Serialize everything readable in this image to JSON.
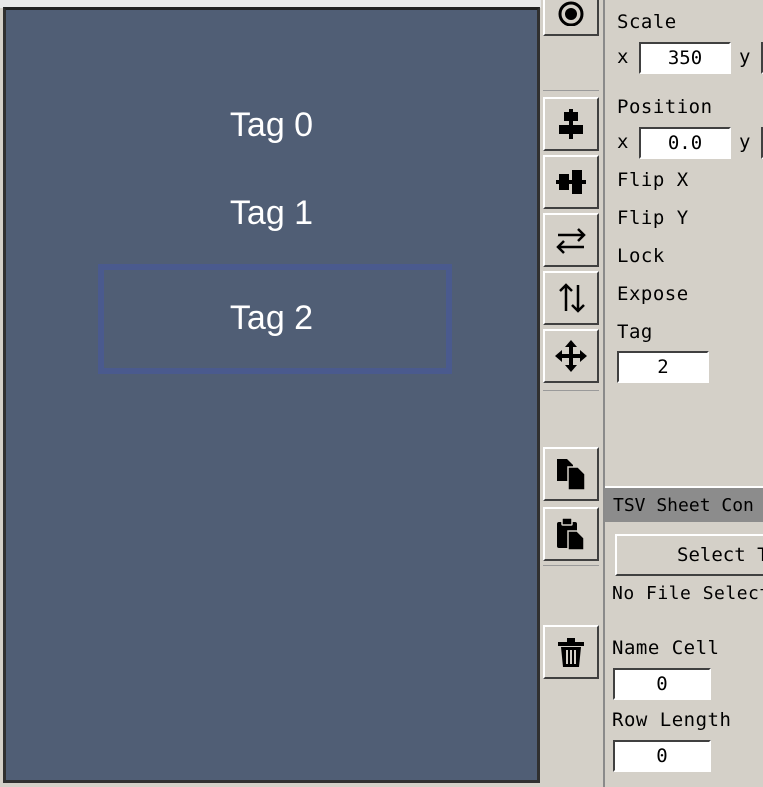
{
  "canvas": {
    "tags": [
      "Tag 0",
      "Tag 1",
      "Tag 2"
    ],
    "selected_index": 2
  },
  "toolbar": {
    "buttons": [
      {
        "name": "record-icon"
      },
      {
        "name": "align-vertical-icon"
      },
      {
        "name": "align-horizontal-icon"
      },
      {
        "name": "flip-horizontal-icon"
      },
      {
        "name": "flip-vertical-icon"
      },
      {
        "name": "move-icon"
      },
      {
        "name": "copy-icon"
      },
      {
        "name": "paste-icon"
      },
      {
        "name": "delete-icon"
      }
    ]
  },
  "properties": {
    "scale_label": "Scale",
    "scale_x_label": "x",
    "scale_x_value": "350",
    "scale_y_label": "y",
    "position_label": "Position",
    "position_x_label": "x",
    "position_x_value": "0.0",
    "position_y_label": "y",
    "flip_x_label": "Flip X",
    "flip_y_label": "Flip Y",
    "lock_label": "Lock",
    "expose_label": "Expose",
    "tag_label": "Tag",
    "tag_value": "2"
  },
  "tsv": {
    "header": "TSV Sheet Con",
    "select_button": "Select T",
    "file_status": "No File Selecte",
    "name_cell_label": "Name Cell",
    "name_cell_value": "0",
    "row_length_label": "Row Length",
    "row_length_value": "0"
  }
}
